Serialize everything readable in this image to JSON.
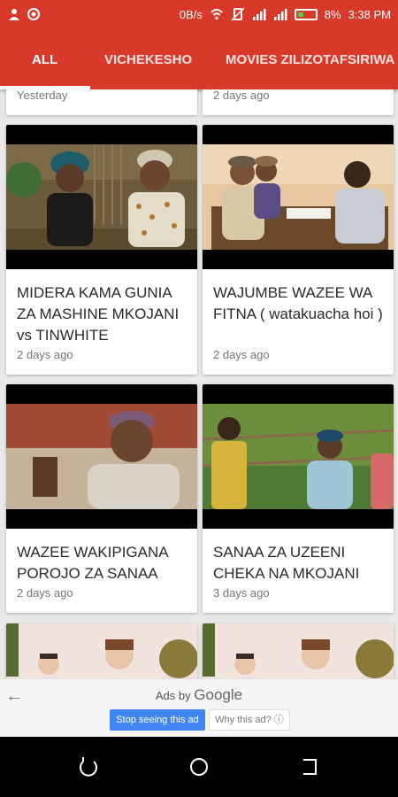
{
  "status_bar": {
    "speed": "0B/s",
    "battery": "8%",
    "time": "3:38 PM"
  },
  "tabs": [
    {
      "label": "ALL",
      "active": true
    },
    {
      "label": "VICHEKESHO",
      "active": false
    },
    {
      "label": "MOVIES ZILIZOTAFSIRIWA",
      "active": false
    }
  ],
  "videos": [
    {
      "title": "",
      "date": "Yesterday"
    },
    {
      "title": "",
      "date": "2 days ago"
    },
    {
      "title": "MIDERA KAMA GUNIA ZA MASHINE MKOJANI vs TINWHITE",
      "date": "2 days ago"
    },
    {
      "title": "WAJUMBE WAZEE WA FITNA ( watakuacha hoi )",
      "date": "2 days ago"
    },
    {
      "title": "WAZEE WAKIPIGANA POROJO ZA SANAA",
      "date": "2 days ago"
    },
    {
      "title": "SANAA ZA UZEENI CHEKA NA MKOJANI",
      "date": "3 days ago"
    },
    {
      "title": "",
      "date": ""
    },
    {
      "title": "",
      "date": ""
    }
  ],
  "ad": {
    "ads_by": "Ads by",
    "brand": "Google",
    "stop_label": "Stop seeing this ad",
    "why_label": "Why this ad? ⓘ"
  },
  "colors": {
    "primary": "#d9392b",
    "ad_button": "#4285f4"
  }
}
